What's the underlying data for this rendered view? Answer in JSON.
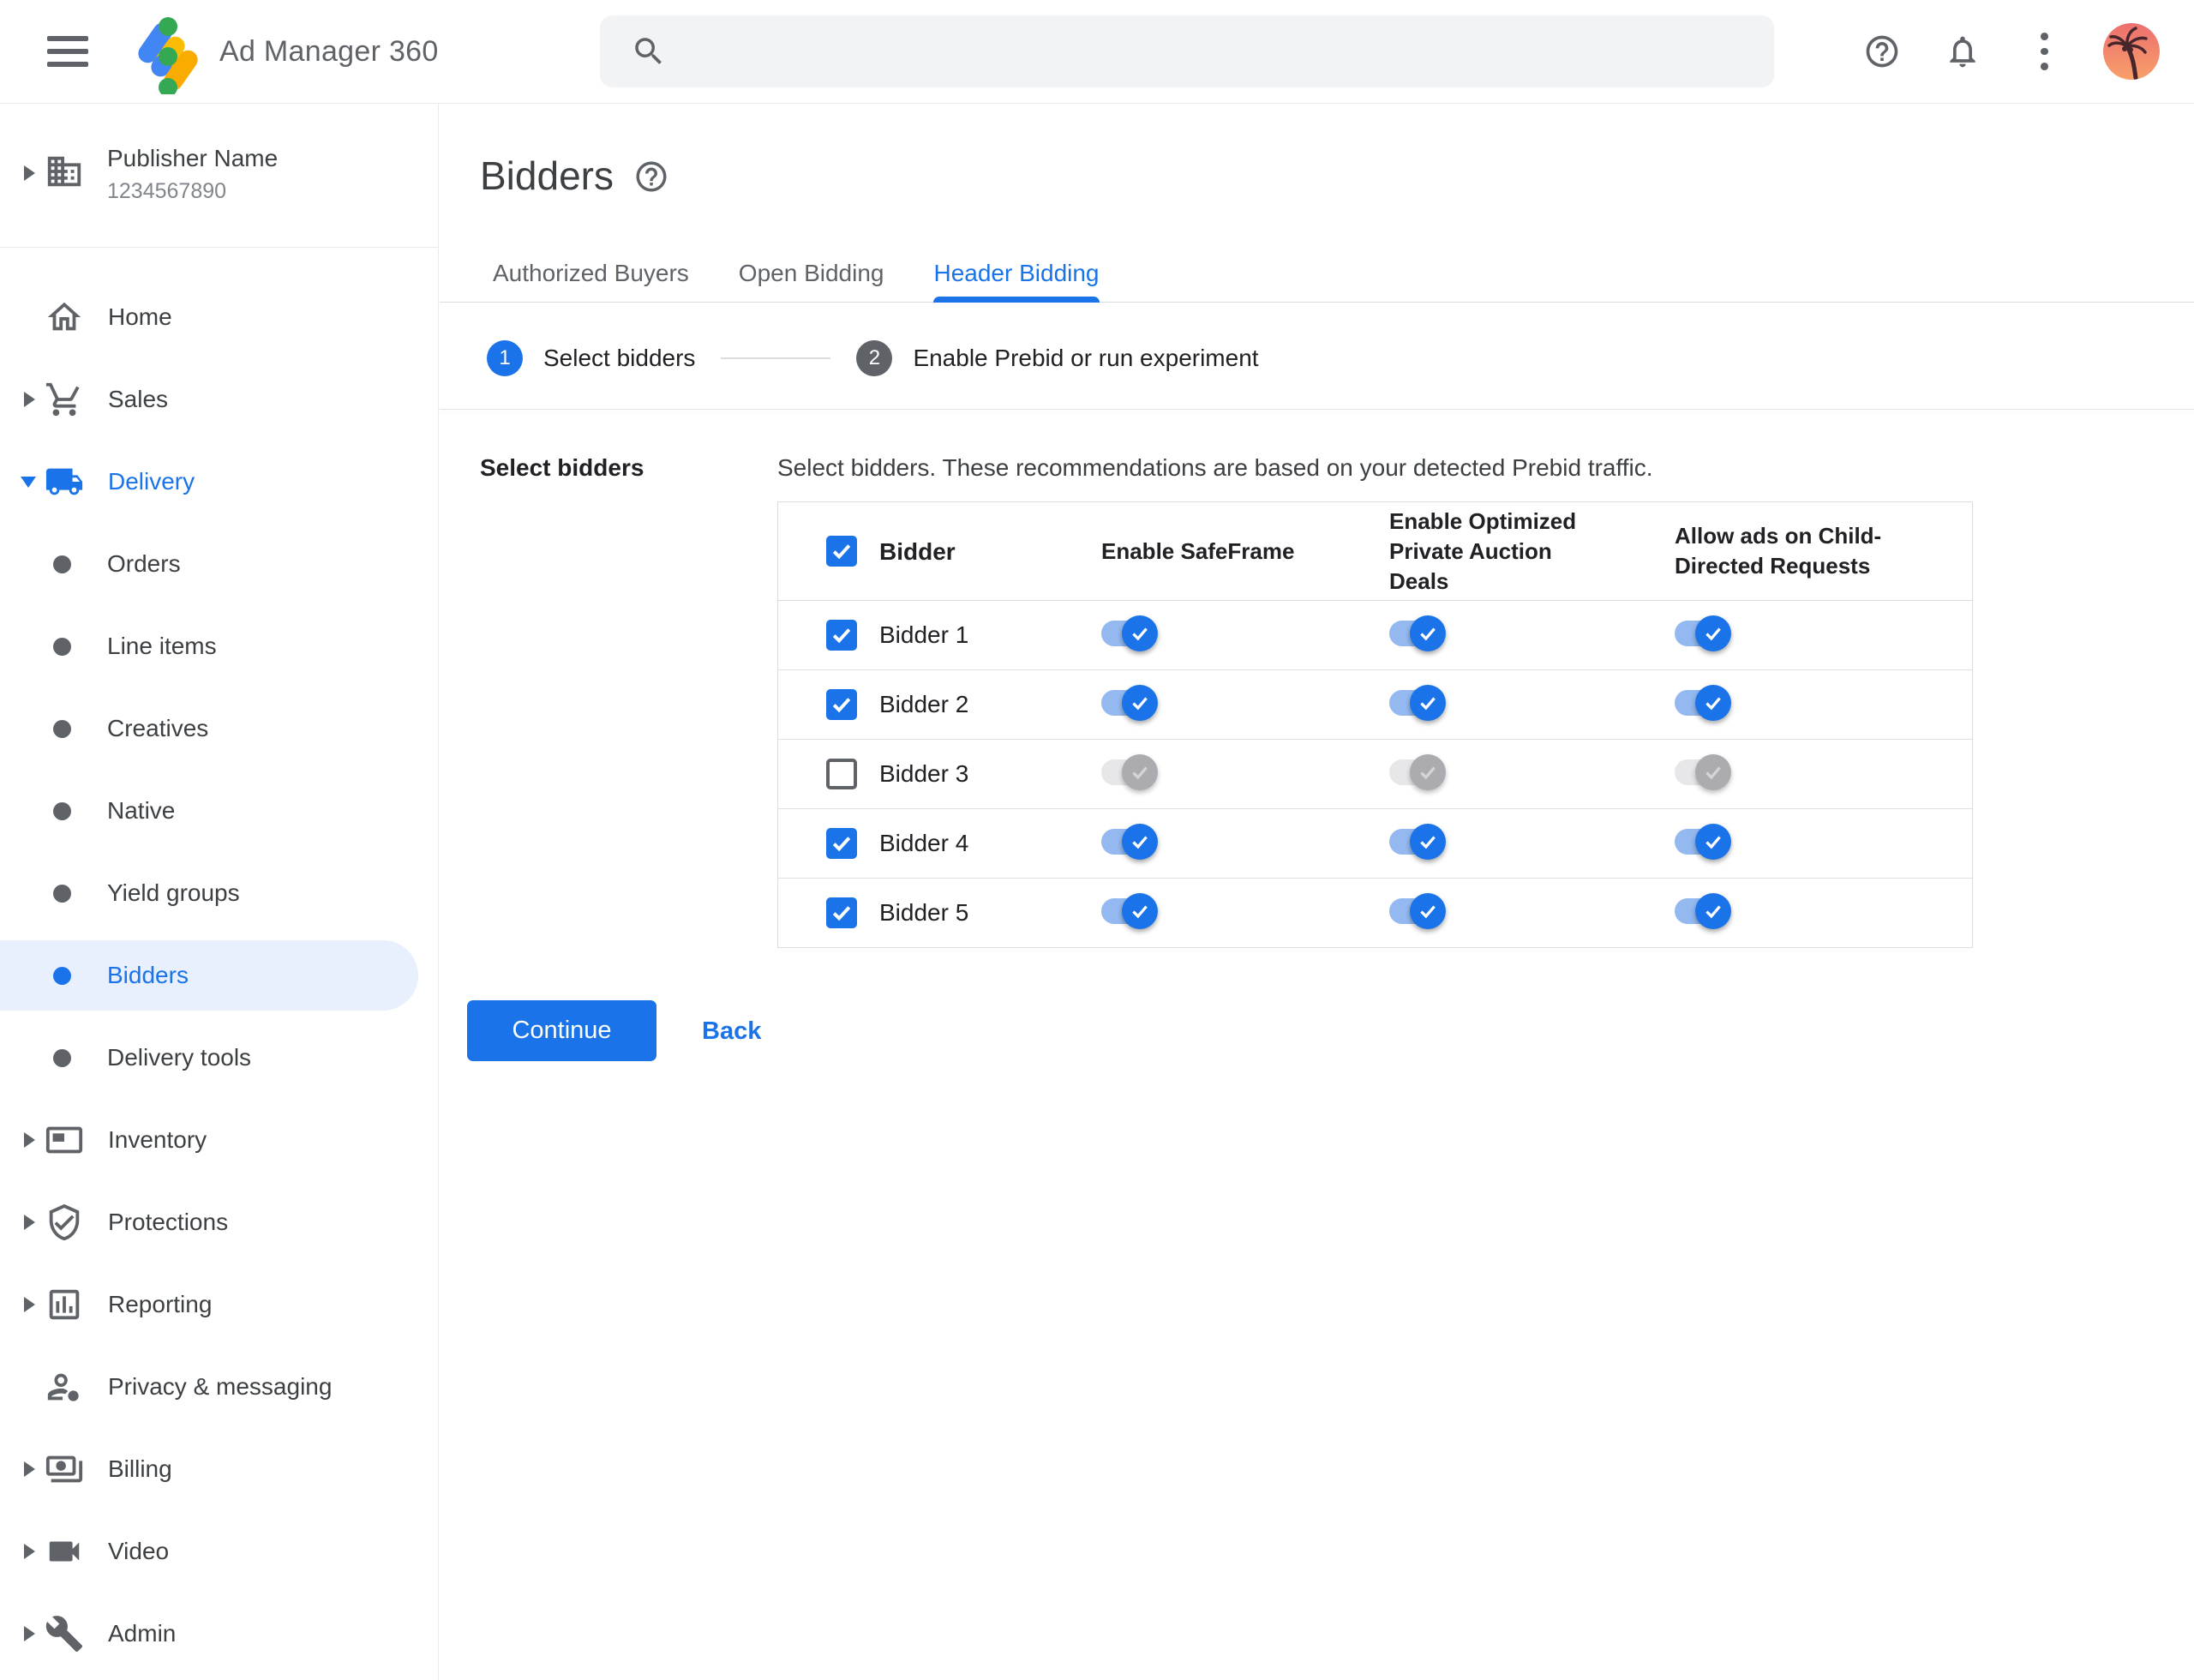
{
  "colors": {
    "accent_blue": "#1a73e8",
    "selected_item_bg": "#e8f0fe",
    "toggle_track_on": "#93b9f0",
    "toggle_thumb_off": "#acacb0",
    "logo_blue": "#4285f4",
    "logo_yellow": "#fbbc04",
    "logo_orange": "#f9ab00",
    "logo_green": "#34a853"
  },
  "topbar": {
    "app_title": "Ad Manager 360",
    "search_value": "",
    "search_placeholder": ""
  },
  "sidebar": {
    "publisher": {
      "name": "Publisher Name",
      "id": "1234567890"
    },
    "items": [
      {
        "label": "Home"
      },
      {
        "label": "Sales"
      },
      {
        "label": "Delivery"
      },
      {
        "label": "Orders"
      },
      {
        "label": "Line items"
      },
      {
        "label": "Creatives"
      },
      {
        "label": "Native"
      },
      {
        "label": "Yield groups"
      },
      {
        "label": "Bidders"
      },
      {
        "label": "Delivery tools"
      },
      {
        "label": "Inventory"
      },
      {
        "label": "Protections"
      },
      {
        "label": "Reporting"
      },
      {
        "label": "Privacy & messaging"
      },
      {
        "label": "Billing"
      },
      {
        "label": "Video"
      },
      {
        "label": "Admin"
      }
    ]
  },
  "main": {
    "page_title": "Bidders",
    "tabs": [
      {
        "label": "Authorized Buyers",
        "active": false
      },
      {
        "label": "Open Bidding",
        "active": false
      },
      {
        "label": "Header Bidding",
        "active": true
      }
    ],
    "stepper": [
      {
        "num": "1",
        "label": "Select bidders",
        "state": "active"
      },
      {
        "num": "2",
        "label": "Enable Prebid or run experiment",
        "state": "upcoming"
      }
    ],
    "section_label": "Select bidders",
    "description": "Select bidders. These recommendations are based on your detected Prebid traffic.",
    "table": {
      "select_all_checked": true,
      "columns": [
        "Bidder",
        "Enable SafeFrame",
        "Enable Optimized Private Auction Deals",
        "Allow ads on Child-Directed Requests"
      ],
      "rows": [
        {
          "name": "Bidder 1",
          "checked": true,
          "enable_safeframe": true,
          "enable_optimized_private_auction_deals": true,
          "allow_ads_child_directed": true
        },
        {
          "name": "Bidder 2",
          "checked": true,
          "enable_safeframe": true,
          "enable_optimized_private_auction_deals": true,
          "allow_ads_child_directed": true
        },
        {
          "name": "Bidder 3",
          "checked": false,
          "enable_safeframe": false,
          "enable_optimized_private_auction_deals": false,
          "allow_ads_child_directed": false
        },
        {
          "name": "Bidder 4",
          "checked": true,
          "enable_safeframe": true,
          "enable_optimized_private_auction_deals": true,
          "allow_ads_child_directed": true
        },
        {
          "name": "Bidder 5",
          "checked": true,
          "enable_safeframe": true,
          "enable_optimized_private_auction_deals": true,
          "allow_ads_child_directed": true
        }
      ]
    },
    "actions": {
      "continue": "Continue",
      "back": "Back"
    }
  }
}
